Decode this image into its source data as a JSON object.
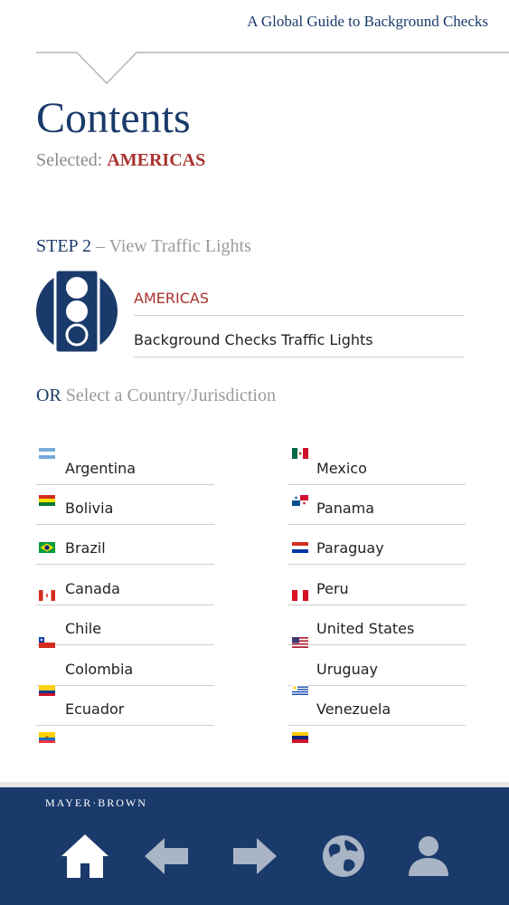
{
  "header": {
    "guide_title": "A Global Guide to Background Checks"
  },
  "page": {
    "title": "Contents",
    "selected_label": "Selected:",
    "selected_value": "AMERICAS"
  },
  "step": {
    "label": "STEP 2",
    "dash": " – ",
    "text": "View Traffic Lights",
    "links": [
      {
        "label": "AMERICAS"
      },
      {
        "label": "Background Checks Traffic Lights"
      }
    ]
  },
  "or_section": {
    "label": "OR",
    "text": " Select a Country/Jurisdiction"
  },
  "countries_left": [
    {
      "name": "Argentina",
      "flag": "argentina-flag-icon"
    },
    {
      "name": "Bolivia",
      "flag": "bolivia-flag-icon"
    },
    {
      "name": "Brazil",
      "flag": "brazil-flag-icon"
    },
    {
      "name": "Canada",
      "flag": "canada-flag-icon"
    },
    {
      "name": "Chile",
      "flag": "chile-flag-icon"
    },
    {
      "name": "Colombia",
      "flag": "colombia-flag-icon"
    },
    {
      "name": "Ecuador",
      "flag": "ecuador-flag-icon"
    }
  ],
  "countries_right": [
    {
      "name": "Mexico",
      "flag": "mexico-flag-icon"
    },
    {
      "name": "Panama",
      "flag": "panama-flag-icon"
    },
    {
      "name": "Paraguay",
      "flag": "paraguay-flag-icon"
    },
    {
      "name": "Peru",
      "flag": "peru-flag-icon"
    },
    {
      "name": "United States",
      "flag": "united-states-flag-icon"
    },
    {
      "name": "Uruguay",
      "flag": "uruguay-flag-icon"
    },
    {
      "name": "Venezuela",
      "flag": "venezuela-flag-icon"
    }
  ],
  "footer": {
    "brand": "MAYER·BROWN",
    "nav_icons": [
      "home-icon",
      "back-arrow-icon",
      "forward-arrow-icon",
      "globe-icon",
      "person-icon"
    ]
  },
  "colors": {
    "navy": "#1a3a6b",
    "accent_red": "#a8332f",
    "muted_gray": "#9a9a9a"
  }
}
